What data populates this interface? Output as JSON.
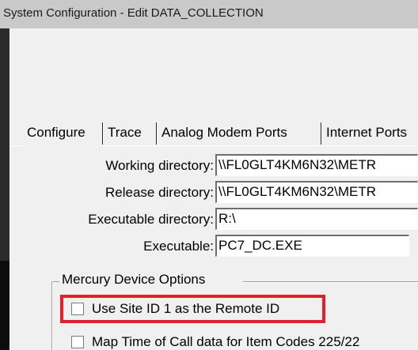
{
  "window": {
    "title": "System Configuration - Edit  DATA_COLLECTION"
  },
  "tabs": [
    {
      "label": "Configure",
      "active": true
    },
    {
      "label": "Trace",
      "active": false
    },
    {
      "label": "Analog Modem Ports",
      "active": false
    },
    {
      "label": "Internet Ports",
      "active": false
    }
  ],
  "form": {
    "working_directory": {
      "label": "Working directory:",
      "value": "\\\\FL0GLT4KM6N32\\METR"
    },
    "release_directory": {
      "label": "Release directory:",
      "value": "\\\\FL0GLT4KM6N32\\METR"
    },
    "executable_directory": {
      "label": "Executable directory:",
      "value": "R:\\"
    },
    "executable": {
      "label": "Executable:",
      "value": "PC7_DC.EXE"
    }
  },
  "mercury": {
    "group_label": "Mercury Device Options",
    "use_site_id": {
      "label": "Use Site ID 1 as the Remote ID",
      "checked": false
    },
    "map_time": {
      "label": "Map Time of Call data for Item Codes 225/22",
      "checked": false
    }
  },
  "colors": {
    "highlight": "#e0202a",
    "window_bg": "#f0f0f0",
    "titlebar_bg": "#c9c9c9"
  }
}
